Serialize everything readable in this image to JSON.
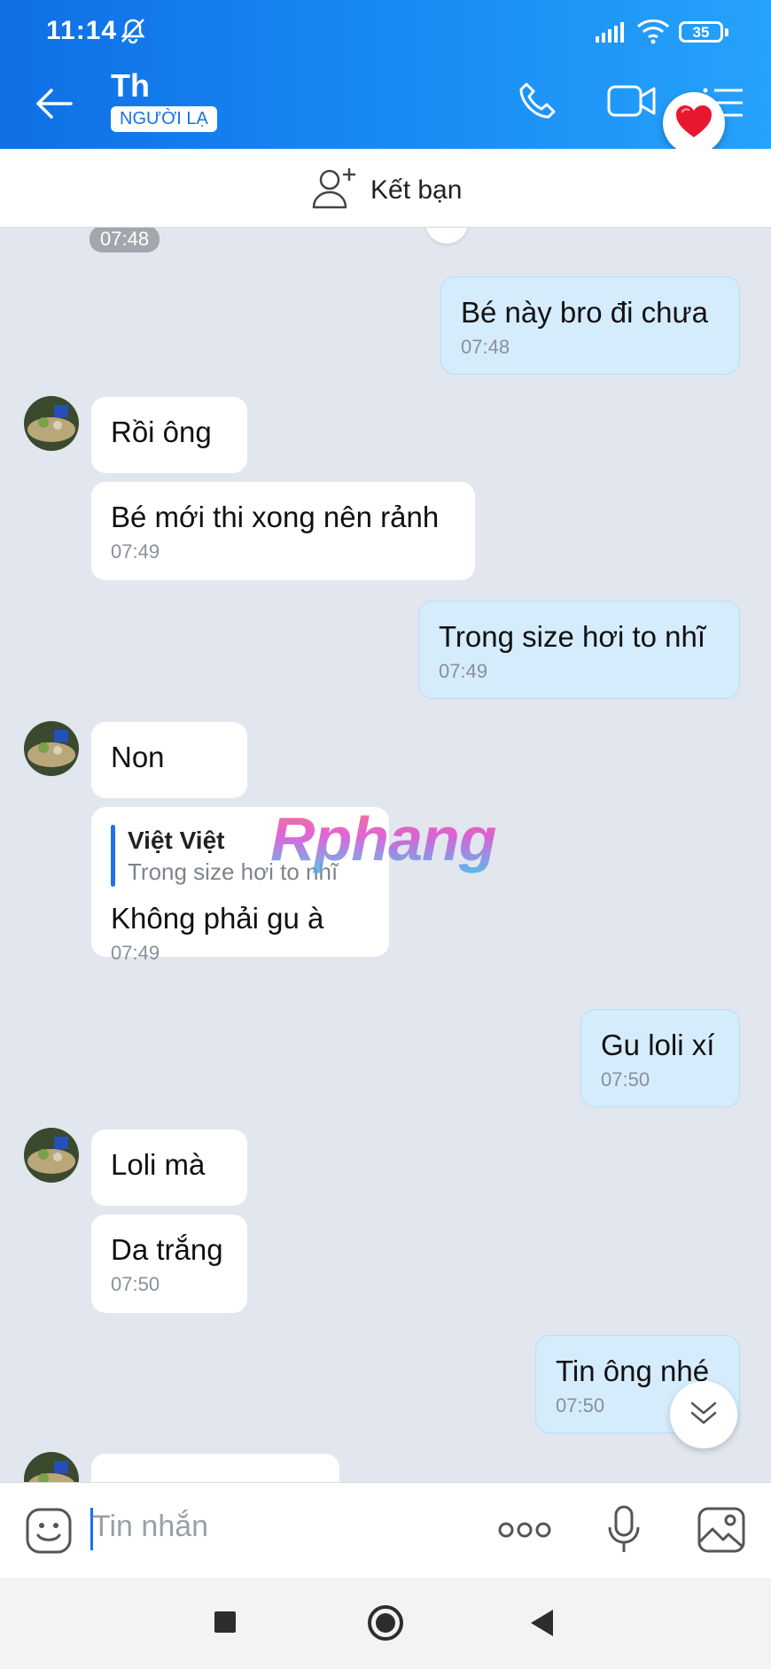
{
  "status": {
    "time": "11:14",
    "battery": "35"
  },
  "header": {
    "name": "Th",
    "tag": "NGƯỜI LẠ"
  },
  "friend_bar": {
    "label": "Kết bạn"
  },
  "chat": {
    "top_time_chip": "07:48",
    "messages": [
      {
        "side": "out",
        "text": "Bé này bro đi chưa",
        "time": "07:48"
      },
      {
        "side": "in",
        "text": "Rồi ông",
        "time": ""
      },
      {
        "side": "in",
        "text": "Bé mới thi xong nên rảnh",
        "time": "07:49"
      },
      {
        "side": "out",
        "text": "Trong size hơi to nhĩ",
        "time": "07:49"
      },
      {
        "side": "in",
        "text": "Non",
        "time": ""
      },
      {
        "side": "in",
        "quote_name": "Việt Việt",
        "quote_text": "Trong size hơi to nhĩ",
        "text": "Không phải gu à",
        "time": "07:49"
      },
      {
        "side": "out",
        "text": "Gu loli xí",
        "time": "07:50"
      },
      {
        "side": "in",
        "text": "Loli mà",
        "time": ""
      },
      {
        "side": "in",
        "text": "Da trắng",
        "time": "07:50"
      },
      {
        "side": "out",
        "text": "Tin ông nhé",
        "time": "07:50"
      }
    ],
    "watermark": "Rphang"
  },
  "input": {
    "placeholder": "Tin nhắn"
  },
  "icons": {
    "back": "arrow-left-icon",
    "call": "phone-icon",
    "video": "video-call-icon",
    "menu": "menu-icon",
    "heart": "heart-icon",
    "add_friend": "add-friend-icon",
    "emoji": "emoji-icon",
    "more": "more-icon",
    "mic": "mic-icon",
    "image": "image-icon",
    "scroll": "chevron-double-down-icon"
  },
  "colors": {
    "header_blue": "#1a8cf5",
    "bubble_out": "#d5ecfd",
    "bubble_in": "#ffffff",
    "chat_bg": "#e2e6ef"
  }
}
